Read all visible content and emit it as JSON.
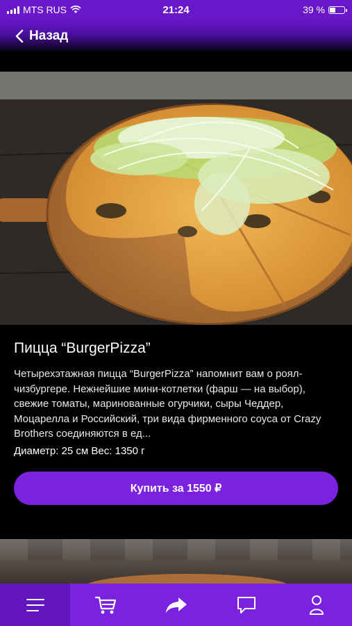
{
  "status_bar": {
    "carrier": "MTS RUS",
    "time": "21:24",
    "battery_percent": "39 %",
    "battery_level": 0.39
  },
  "nav": {
    "back_label": "Назад",
    "back_icon": "chevron-left-icon"
  },
  "product": {
    "image": "pizza-photo",
    "title": "Пицца “BurgerPizza”",
    "description": "Четырехэтажная пицца “BurgerPizza” напомнит вам о роял-чизбургере. Нежнейшие мини-котлетки (фарш — на выбор), свежие томаты, маринованные огурчики, сыры Чеддер, Моцарелла и Российский, три вида фирменного соуса от Crazy Brothers соединяются в ед...",
    "specs": "Диаметр: 25 см Вес: 1350 г",
    "buy_label": "Купить за 1550 ₽"
  },
  "tab_bar": {
    "active_tab": "menu",
    "tabs": [
      {
        "id": "menu",
        "icon": "menu-lines-icon"
      },
      {
        "id": "cart",
        "icon": "cart-icon"
      },
      {
        "id": "share",
        "icon": "share-arrow-icon"
      },
      {
        "id": "chat",
        "icon": "chat-bubble-icon"
      },
      {
        "id": "profile",
        "icon": "profile-icon"
      }
    ]
  },
  "colors": {
    "accent": "#7b22e0",
    "accent_dark": "#6316bd",
    "status_bar": "#6a16c9"
  }
}
